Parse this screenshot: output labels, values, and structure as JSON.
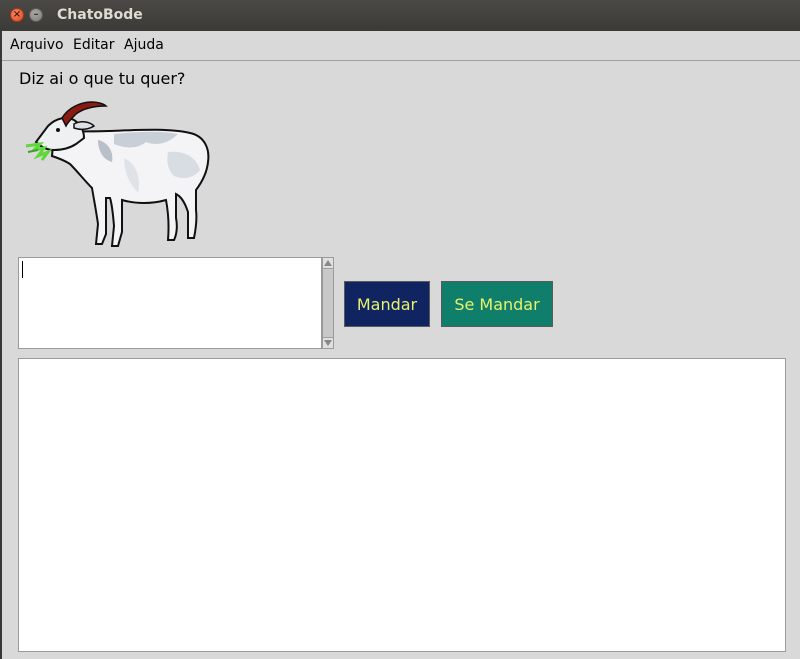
{
  "window": {
    "title": "ChatoBode"
  },
  "menu": {
    "items": [
      "Arquivo",
      "Editar",
      "Ajuda"
    ]
  },
  "prompt": {
    "label": "Diz ai o que tu quer?"
  },
  "input": {
    "value": ""
  },
  "buttons": {
    "send": "Mandar",
    "quit": "Se Mandar"
  },
  "colors": {
    "send_button_bg": "#0f2461",
    "quit_button_bg": "#0f7f6c",
    "button_text": "#e7f26a",
    "window_bg": "#d9d9d9"
  },
  "icons": {
    "image": "goat-icon",
    "close": "close-icon",
    "minimize": "minimize-icon"
  }
}
